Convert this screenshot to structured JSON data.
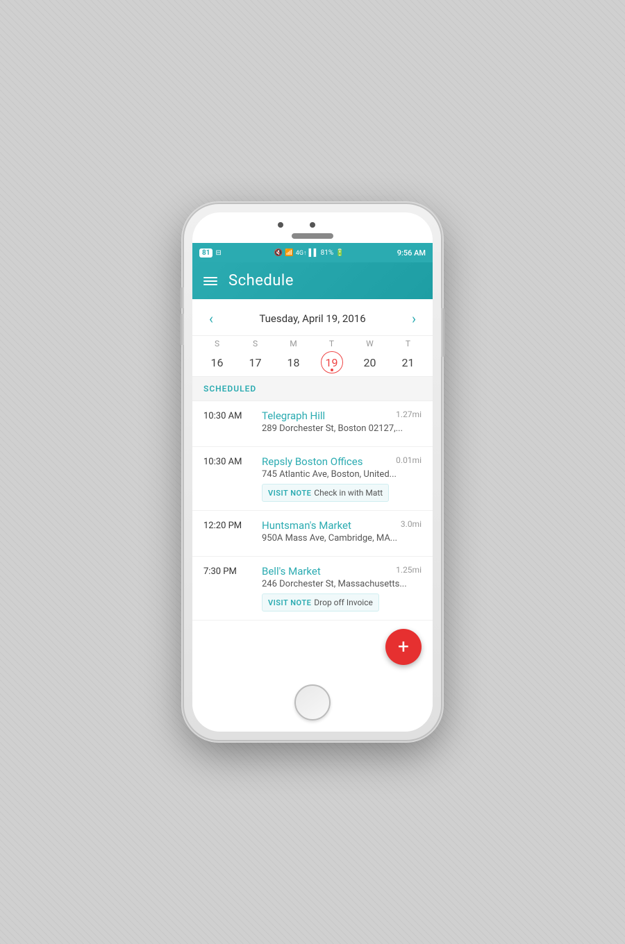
{
  "status_bar": {
    "badge": "81",
    "time": "9:56 AM",
    "battery": "81%"
  },
  "header": {
    "title": "Schedule",
    "menu_icon": "≡"
  },
  "calendar": {
    "nav_date": "Tuesday, April 19, 2016",
    "prev_arrow": "‹",
    "next_arrow": "›",
    "days": [
      {
        "letter": "S",
        "number": "16",
        "today": false
      },
      {
        "letter": "S",
        "number": "17",
        "today": false
      },
      {
        "letter": "M",
        "number": "18",
        "today": false
      },
      {
        "letter": "T",
        "number": "19",
        "today": true
      },
      {
        "letter": "W",
        "number": "20",
        "today": false
      },
      {
        "letter": "T",
        "number": "21",
        "today": false
      }
    ]
  },
  "section_label": "SCHEDULED",
  "schedule_items": [
    {
      "time": "10:30 AM",
      "name": "Telegraph Hill",
      "distance": "1.27mi",
      "address": "289 Dorchester St, Boston 02127,...",
      "visit_note": null
    },
    {
      "time": "10:30 AM",
      "name": "Repsly Boston Offices",
      "distance": "0.01mi",
      "address": "745 Atlantic Ave, Boston, United...",
      "visit_note": "Check in with Matt"
    },
    {
      "time": "12:20 PM",
      "name": "Huntsman's Market",
      "distance": "3.0mi",
      "address": "950A Mass Ave, Cambridge, MA...",
      "visit_note": null
    },
    {
      "time": "7:30 PM",
      "name": "Bell's Market",
      "distance": "1.25mi",
      "address": "246 Dorchester St, Massachusetts...",
      "visit_note": "Drop off Invoice"
    }
  ],
  "fab_label": "+",
  "visit_note_label": "VISIT NOTE"
}
